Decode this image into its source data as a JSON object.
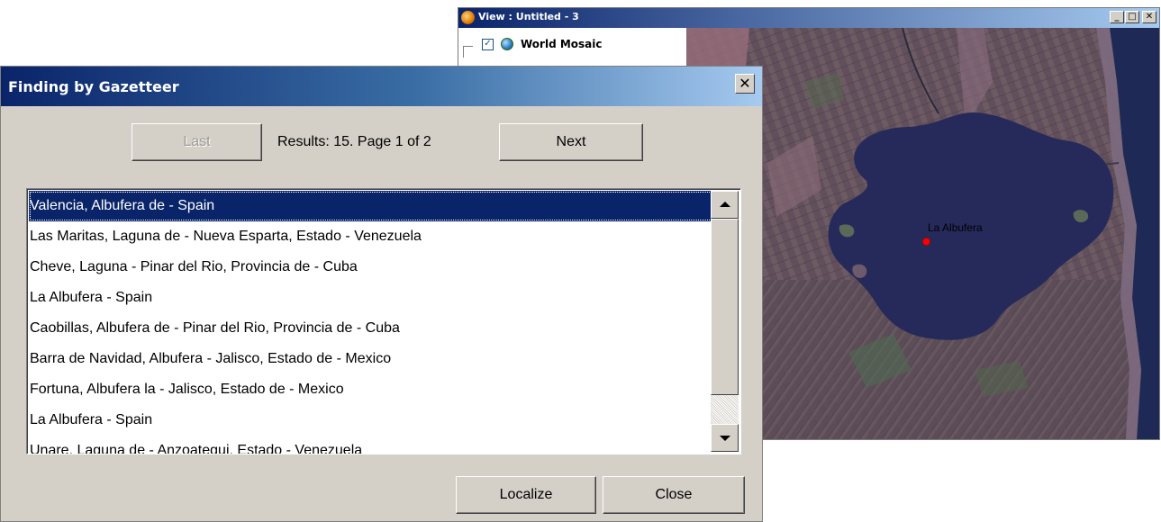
{
  "view_window": {
    "title": "View : Untitled - 3",
    "buttons": {
      "minimize": "_",
      "maximize": "□",
      "close": "✕"
    },
    "layer": {
      "name": "World Mosaic",
      "checked": true,
      "check_mark": "✓"
    },
    "map_marker_label": "La Albufera"
  },
  "dialog": {
    "title": "Finding by Gazetteer",
    "close_glyph": "✕",
    "last_label": "Last",
    "last_enabled": false,
    "next_label": "Next",
    "results_text": "Results: 15. Page 1 of  2",
    "localize_label": "Localize",
    "close_label": "Close",
    "selected_index": 0,
    "results": [
      "Valencia, Albufera de - Spain",
      "Las Maritas, Laguna de - Nueva Esparta, Estado - Venezuela",
      "Cheve, Laguna - Pinar del Rio, Provincia de - Cuba",
      "La Albufera - Spain",
      "Caobillas, Albufera de - Pinar del Rio, Provincia de - Cuba",
      "Barra de Navidad, Albufera - Jalisco, Estado de - Mexico",
      "Fortuna, Albufera la - Jalisco, Estado de - Mexico",
      "La Albufera - Spain",
      "Unare, Laguna de - Anzoategui, Estado - Venezuela"
    ]
  },
  "colors": {
    "title_bar": "#0a246a",
    "selection": "#0a246a",
    "window_face": "#d4d0c8",
    "marker": "#ff0000"
  }
}
